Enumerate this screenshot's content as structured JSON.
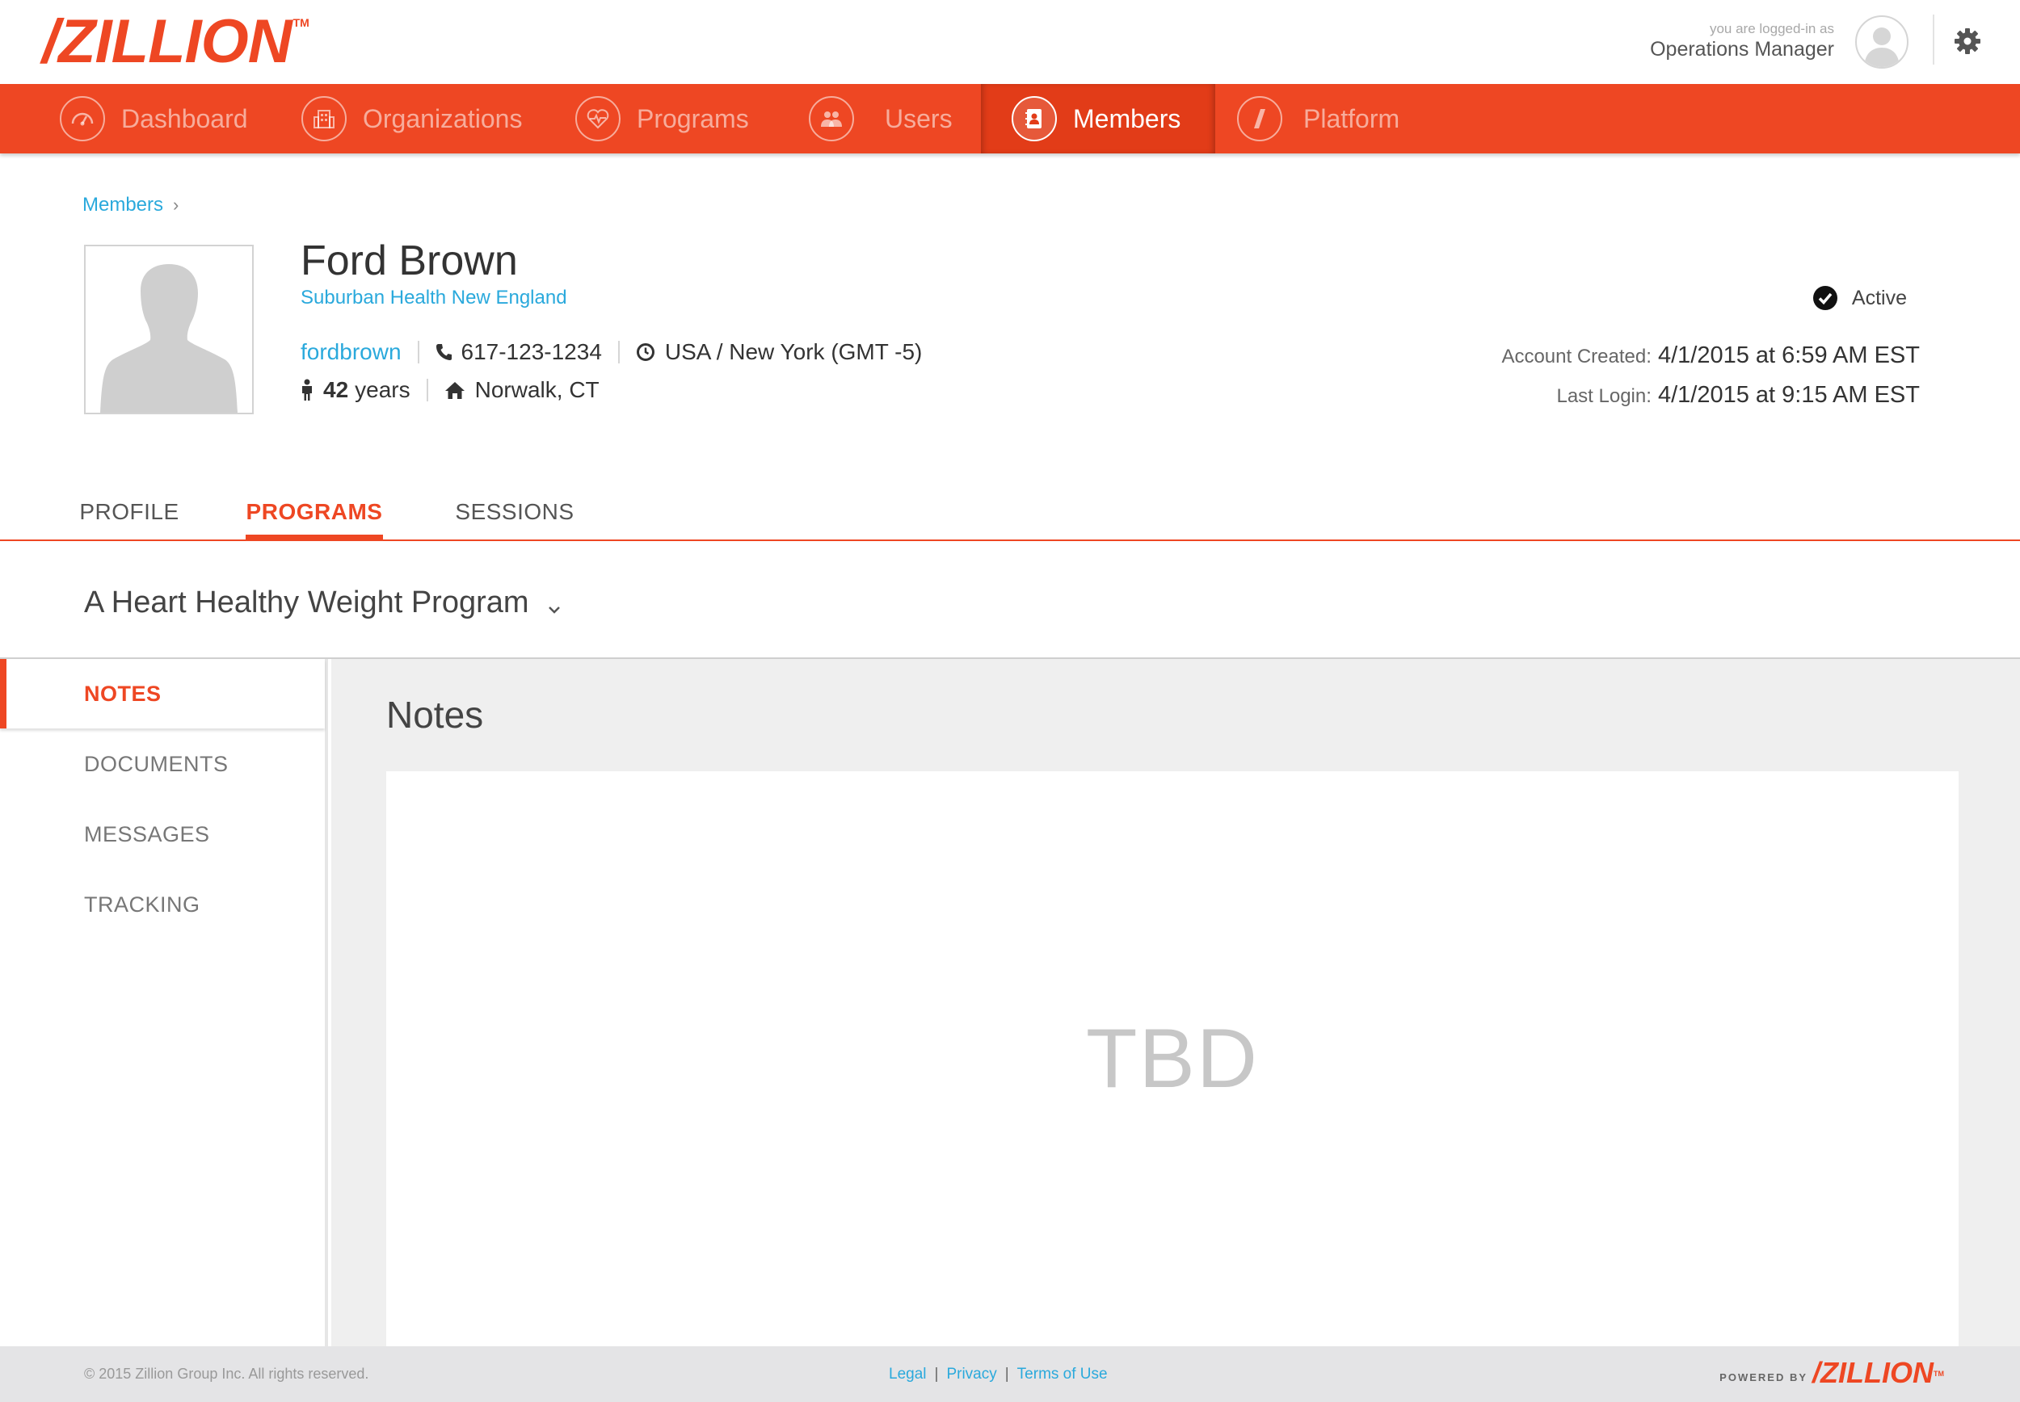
{
  "brand": {
    "logo": "/ZILLION",
    "tm": "TM",
    "accent_color": "#ee4723",
    "link_color": "#2aa9dc"
  },
  "header": {
    "logged_in_label": "you are logged-in as",
    "role": "Operations Manager",
    "avatar_icon": "user-avatar-icon",
    "settings_icon": "gear-icon"
  },
  "nav": {
    "items": [
      {
        "label": "Dashboard",
        "icon": "speedometer-icon",
        "active": false
      },
      {
        "label": "Organizations",
        "icon": "building-icon",
        "active": false
      },
      {
        "label": "Programs",
        "icon": "heart-pulse-icon",
        "active": false
      },
      {
        "label": "Users",
        "icon": "users-icon",
        "active": false
      },
      {
        "label": "Members",
        "icon": "contact-book-icon",
        "active": true
      },
      {
        "label": "Platform",
        "icon": "slash-icon",
        "active": false
      }
    ]
  },
  "breadcrumb": {
    "link": "Members"
  },
  "member": {
    "name": "Ford Brown",
    "organization": "Suburban Health New England",
    "username": "fordbrown",
    "phone": "617-123-1234",
    "timezone": "USA / New York (GMT -5)",
    "age_value": "42",
    "age_unit": "years",
    "location": "Norwalk, CT",
    "status": "Active",
    "account_created_label": "Account Created:",
    "account_created_value": "4/1/2015 at 6:59 AM EST",
    "last_login_label": "Last Login:",
    "last_login_value": "4/1/2015 at 9:15 AM EST"
  },
  "tabs": [
    {
      "label": "PROFILE",
      "active": false
    },
    {
      "label": "PROGRAMS",
      "active": true
    },
    {
      "label": "SESSIONS",
      "active": false
    }
  ],
  "program": {
    "selected": "A Heart Healthy Weight Program"
  },
  "side_nav": [
    {
      "label": "NOTES",
      "active": true
    },
    {
      "label": "DOCUMENTS",
      "active": false
    },
    {
      "label": "MESSAGES",
      "active": false
    },
    {
      "label": "TRACKING",
      "active": false
    }
  ],
  "content": {
    "title": "Notes",
    "placeholder": "TBD"
  },
  "footer": {
    "copyright": "© 2015 Zillion Group Inc. All rights reserved.",
    "links": [
      "Legal",
      "Privacy",
      "Terms of Use"
    ],
    "separator": "|",
    "powered_by": "POWERED BY",
    "powered_logo": "/ZILLION",
    "powered_tm": "TM"
  }
}
